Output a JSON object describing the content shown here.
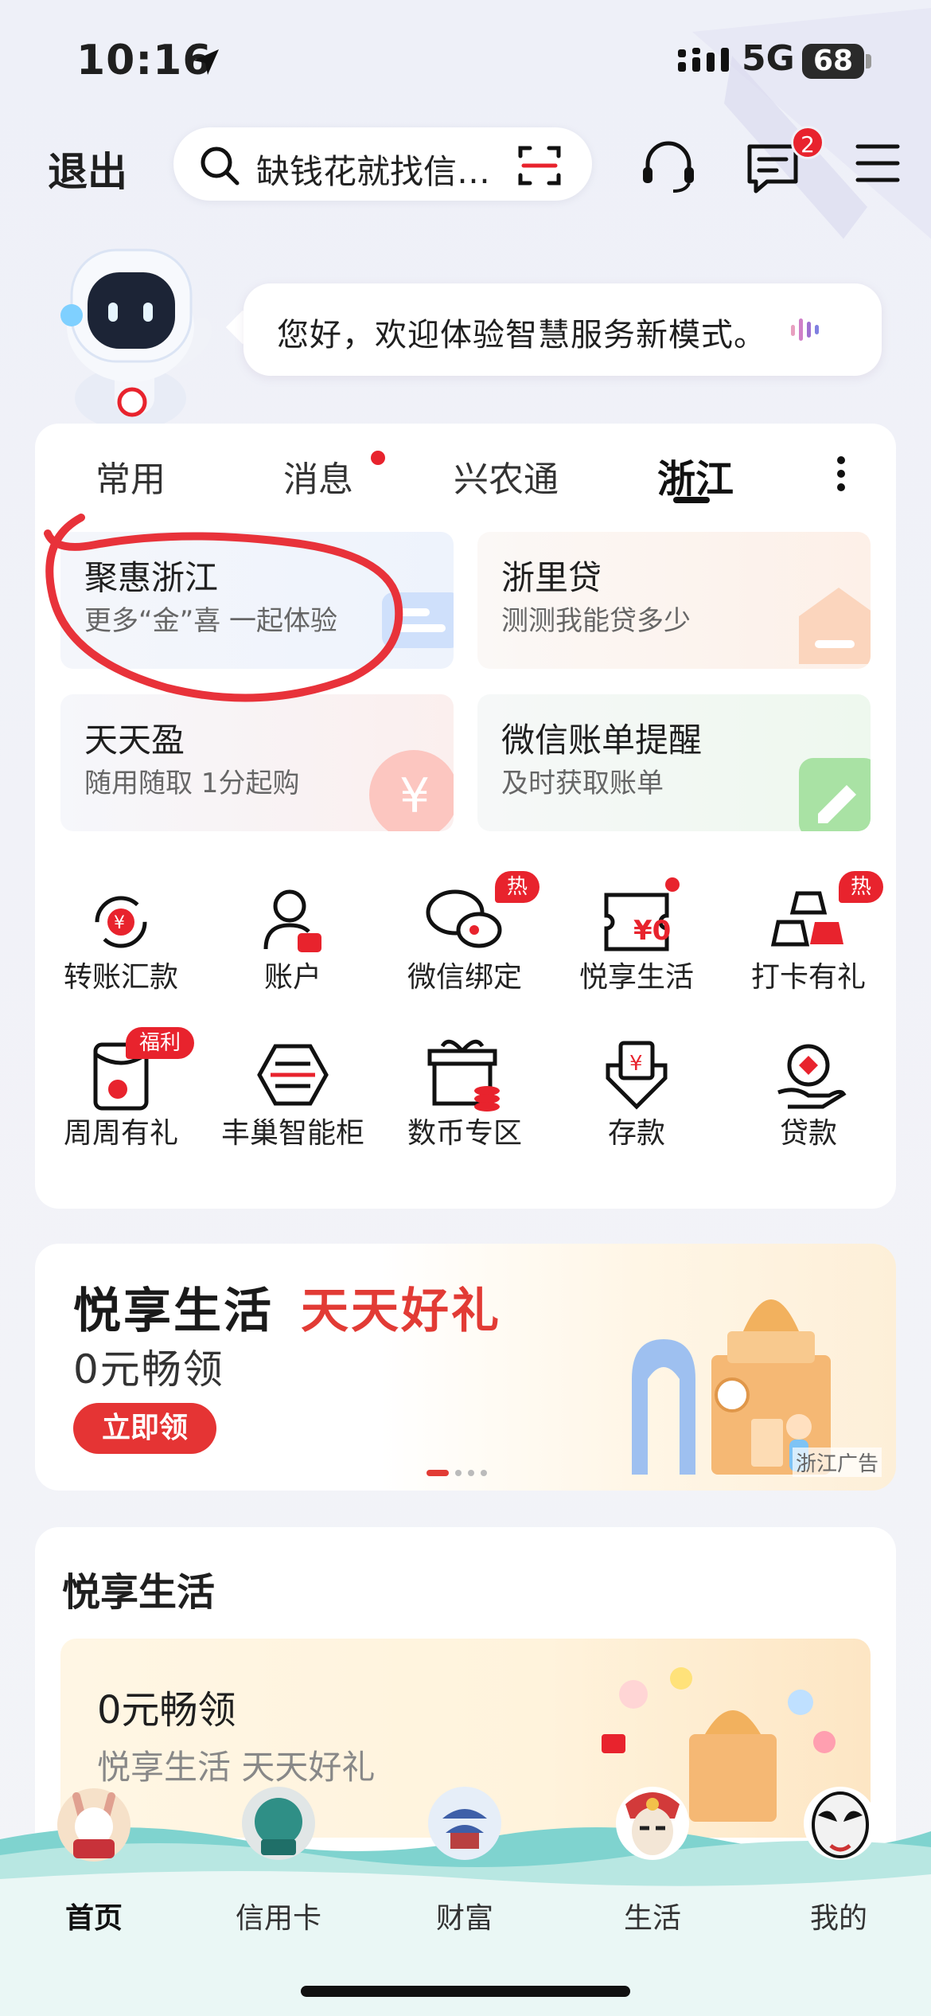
{
  "status_bar": {
    "time": "10:16",
    "network": "5G",
    "battery": "68"
  },
  "header": {
    "exit_label": "退出",
    "search_placeholder": "缺钱花就找信…",
    "message_badge": "2"
  },
  "welcome": {
    "text": "您好，欢迎体验智慧服务新模式。"
  },
  "tabs": [
    {
      "label": "常用"
    },
    {
      "label": "消息"
    },
    {
      "label": "兴农通"
    },
    {
      "label": "浙江",
      "active": true
    }
  ],
  "tiles": [
    {
      "title": "聚惠浙江",
      "subtitle": "更多“金”喜 一起体验"
    },
    {
      "title": "浙里贷",
      "subtitle": "测测我能贷多少"
    },
    {
      "title": "天天盈",
      "subtitle": "随用随取 1分起购"
    },
    {
      "title": "微信账单提醒",
      "subtitle": "及时获取账单"
    }
  ],
  "functions": [
    {
      "label": "转账汇款"
    },
    {
      "label": "账户"
    },
    {
      "label": "微信绑定",
      "badge": "热"
    },
    {
      "label": "悦享生活"
    },
    {
      "label": "打卡有礼",
      "badge": "热"
    },
    {
      "label": "周周有礼",
      "badge": "福利"
    },
    {
      "label": "丰巢智能柜"
    },
    {
      "label": "数币专区"
    },
    {
      "label": "存款"
    },
    {
      "label": "贷款"
    }
  ],
  "banner": {
    "title_part1": "悦享生活",
    "title_part2": "天天好礼",
    "subtitle": "0元畅领",
    "button": "立即领",
    "ad_tag": "浙江广告"
  },
  "section2": {
    "title": "悦享生活",
    "card_title": "0元畅领",
    "card_subtitle": "悦享生活 天天好礼"
  },
  "bottom_nav": [
    {
      "label": "首页",
      "active": true
    },
    {
      "label": "信用卡"
    },
    {
      "label": "财富"
    },
    {
      "label": "生活"
    },
    {
      "label": "我的"
    }
  ],
  "colors": {
    "accent_red": "#e8232d",
    "annotation_red": "#e8323a"
  }
}
